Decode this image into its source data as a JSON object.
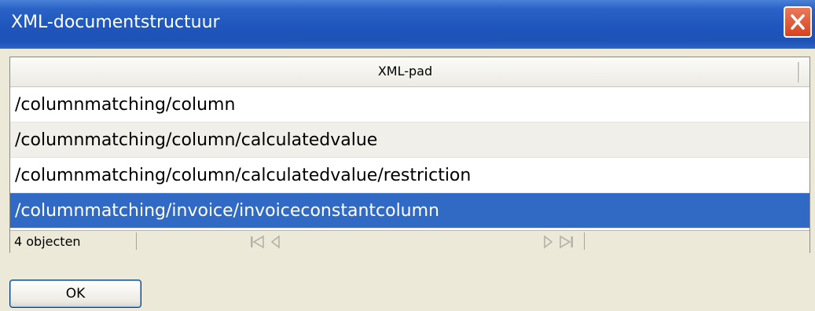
{
  "window": {
    "title": "XML-documentstructuur",
    "close_icon": "close-icon"
  },
  "grid": {
    "column_header": "XML-pad",
    "rows": [
      "/columnmatching/column",
      "/columnmatching/column/calculatedvalue",
      "/columnmatching/column/calculatedvalue/restriction",
      "/columnmatching/invoice/invoiceconstantcolumn"
    ],
    "selected_row": 3
  },
  "statusbar": {
    "count_text": "4 objecten",
    "icons": [
      "first-page-icon",
      "previous-page-icon",
      "next-page-icon",
      "last-page-icon"
    ]
  },
  "buttons": {
    "ok_label": "OK"
  },
  "colors": {
    "titlebar": "#1f56bd",
    "selection": "#316ac5",
    "close_button": "#d8431d"
  }
}
